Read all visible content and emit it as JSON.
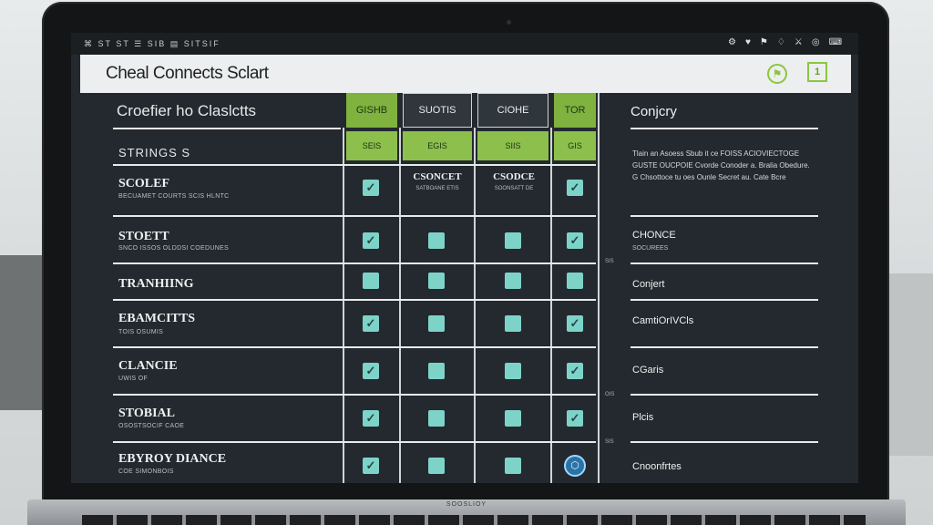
{
  "os_bar": {
    "menu": "⌘ ST ST ☰ SIB ▤ SITSIF",
    "icons": [
      "⚙",
      "♥",
      "⚑",
      "♢",
      "⚔",
      "◎",
      "⌨"
    ]
  },
  "app": {
    "title": "Cheal Connects Sclart",
    "icon_a": "⚑",
    "icon_b": "1"
  },
  "grid": {
    "title": "Croefier ho Claslctts",
    "subheader_label": "STRINGS S",
    "columns": [
      {
        "label": "GISHB",
        "sub": "SEIS"
      },
      {
        "label": "SUOTIS",
        "sub": "EGIS"
      },
      {
        "label": "CIOHE",
        "sub": "SIIS"
      },
      {
        "label": "TOR",
        "sub": "GIS"
      }
    ],
    "rows": [
      {
        "title": "SCOLEF",
        "sub": "BECUAMET COURTS SCIS HLNTC",
        "cells": [
          "check",
          "text",
          "text",
          "check"
        ],
        "cell_text": [
          "",
          "CSONCET",
          "CSODCE",
          ""
        ],
        "cell_sub": [
          "",
          "SATBOANE ETIS",
          "SOONSATT DE",
          ""
        ]
      },
      {
        "title": "STOETT",
        "sub": "SNCO ISSOS OLDDSI COEDUNES",
        "cells": [
          "check",
          "empty",
          "empty",
          "check"
        ]
      },
      {
        "title": "TRANHIING",
        "sub": "",
        "cells": [
          "empty",
          "empty",
          "empty",
          "empty"
        ]
      },
      {
        "title": "EBAMCITTS",
        "sub": "TOIS OSUMIS",
        "cells": [
          "check",
          "empty",
          "empty",
          "check"
        ]
      },
      {
        "title": "CLANCIE",
        "sub": "UWIS OF",
        "cells": [
          "check",
          "empty",
          "empty",
          "check"
        ]
      },
      {
        "title": "STOBIAL",
        "sub": "OSOSTSOCIF CAOE",
        "cells": [
          "check",
          "empty",
          "empty",
          "check"
        ]
      },
      {
        "title": "EBYROY DIANCE",
        "sub": "COE SIMONBOIS",
        "cells": [
          "check",
          "empty",
          "empty",
          "special"
        ]
      }
    ],
    "check_mark": "✓",
    "special_mark": "⬡"
  },
  "right_panel": {
    "title": "Conjcry",
    "paragraph": "Tlain an Asoess Sbub it ce FOISS ACIOVIECTOGE GUSTE OUCPOIE Cvorde Conoder a. Bralia Obedure. G Chsottoce tu oes Ounle Secret au. Cate Bcre",
    "items": [
      {
        "label": "CHONCE",
        "sub": "SOCUREES"
      },
      {
        "label": "Conjert",
        "sub": ""
      },
      {
        "label": "CamtiOrIVCls",
        "sub": ""
      },
      {
        "label": "CGaris",
        "sub": ""
      },
      {
        "label": "Plcis",
        "sub": ""
      },
      {
        "label": "Cnoonfrtes",
        "sub": ""
      }
    ],
    "side_marks": [
      "SIS",
      "OIS",
      "SIS"
    ]
  },
  "laptop": {
    "brand_label": "SOOSLIOY"
  },
  "colors": {
    "accent_green": "#8cc63f",
    "check_teal": "#7ed3c9",
    "screen_bg": "#23292e"
  }
}
